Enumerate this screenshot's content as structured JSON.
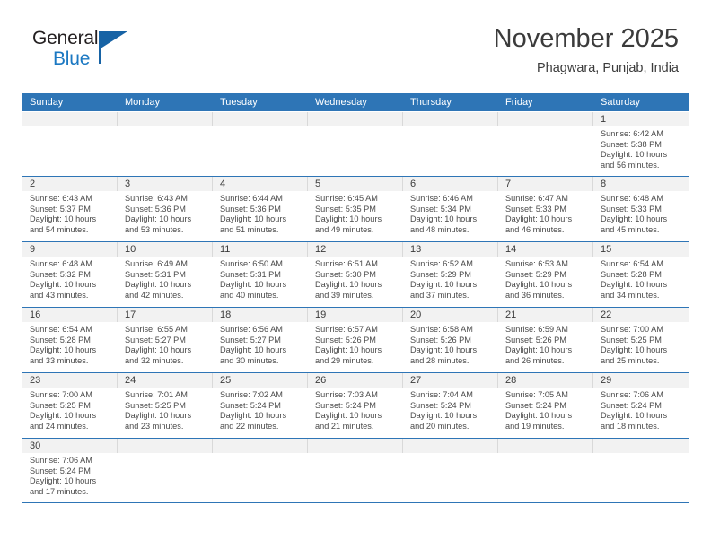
{
  "brand": {
    "name_part1": "General",
    "name_part2": "Blue"
  },
  "header": {
    "title": "November 2025",
    "subtitle": "Phagwara, Punjab, India"
  },
  "colors": {
    "header_blue": "#2e75b6",
    "brand_blue": "#1b78c2",
    "daynum_band": "#f2f2f2",
    "text": "#3b3b3b"
  },
  "weekdays": [
    "Sunday",
    "Monday",
    "Tuesday",
    "Wednesday",
    "Thursday",
    "Friday",
    "Saturday"
  ],
  "weeks": [
    [
      {
        "empty": true
      },
      {
        "empty": true
      },
      {
        "empty": true
      },
      {
        "empty": true
      },
      {
        "empty": true
      },
      {
        "empty": true
      },
      {
        "day": "1",
        "sunrise": "Sunrise: 6:42 AM",
        "sunset": "Sunset: 5:38 PM",
        "daylight1": "Daylight: 10 hours",
        "daylight2": "and 56 minutes."
      }
    ],
    [
      {
        "day": "2",
        "sunrise": "Sunrise: 6:43 AM",
        "sunset": "Sunset: 5:37 PM",
        "daylight1": "Daylight: 10 hours",
        "daylight2": "and 54 minutes."
      },
      {
        "day": "3",
        "sunrise": "Sunrise: 6:43 AM",
        "sunset": "Sunset: 5:36 PM",
        "daylight1": "Daylight: 10 hours",
        "daylight2": "and 53 minutes."
      },
      {
        "day": "4",
        "sunrise": "Sunrise: 6:44 AM",
        "sunset": "Sunset: 5:36 PM",
        "daylight1": "Daylight: 10 hours",
        "daylight2": "and 51 minutes."
      },
      {
        "day": "5",
        "sunrise": "Sunrise: 6:45 AM",
        "sunset": "Sunset: 5:35 PM",
        "daylight1": "Daylight: 10 hours",
        "daylight2": "and 49 minutes."
      },
      {
        "day": "6",
        "sunrise": "Sunrise: 6:46 AM",
        "sunset": "Sunset: 5:34 PM",
        "daylight1": "Daylight: 10 hours",
        "daylight2": "and 48 minutes."
      },
      {
        "day": "7",
        "sunrise": "Sunrise: 6:47 AM",
        "sunset": "Sunset: 5:33 PM",
        "daylight1": "Daylight: 10 hours",
        "daylight2": "and 46 minutes."
      },
      {
        "day": "8",
        "sunrise": "Sunrise: 6:48 AM",
        "sunset": "Sunset: 5:33 PM",
        "daylight1": "Daylight: 10 hours",
        "daylight2": "and 45 minutes."
      }
    ],
    [
      {
        "day": "9",
        "sunrise": "Sunrise: 6:48 AM",
        "sunset": "Sunset: 5:32 PM",
        "daylight1": "Daylight: 10 hours",
        "daylight2": "and 43 minutes."
      },
      {
        "day": "10",
        "sunrise": "Sunrise: 6:49 AM",
        "sunset": "Sunset: 5:31 PM",
        "daylight1": "Daylight: 10 hours",
        "daylight2": "and 42 minutes."
      },
      {
        "day": "11",
        "sunrise": "Sunrise: 6:50 AM",
        "sunset": "Sunset: 5:31 PM",
        "daylight1": "Daylight: 10 hours",
        "daylight2": "and 40 minutes."
      },
      {
        "day": "12",
        "sunrise": "Sunrise: 6:51 AM",
        "sunset": "Sunset: 5:30 PM",
        "daylight1": "Daylight: 10 hours",
        "daylight2": "and 39 minutes."
      },
      {
        "day": "13",
        "sunrise": "Sunrise: 6:52 AM",
        "sunset": "Sunset: 5:29 PM",
        "daylight1": "Daylight: 10 hours",
        "daylight2": "and 37 minutes."
      },
      {
        "day": "14",
        "sunrise": "Sunrise: 6:53 AM",
        "sunset": "Sunset: 5:29 PM",
        "daylight1": "Daylight: 10 hours",
        "daylight2": "and 36 minutes."
      },
      {
        "day": "15",
        "sunrise": "Sunrise: 6:54 AM",
        "sunset": "Sunset: 5:28 PM",
        "daylight1": "Daylight: 10 hours",
        "daylight2": "and 34 minutes."
      }
    ],
    [
      {
        "day": "16",
        "sunrise": "Sunrise: 6:54 AM",
        "sunset": "Sunset: 5:28 PM",
        "daylight1": "Daylight: 10 hours",
        "daylight2": "and 33 minutes."
      },
      {
        "day": "17",
        "sunrise": "Sunrise: 6:55 AM",
        "sunset": "Sunset: 5:27 PM",
        "daylight1": "Daylight: 10 hours",
        "daylight2": "and 32 minutes."
      },
      {
        "day": "18",
        "sunrise": "Sunrise: 6:56 AM",
        "sunset": "Sunset: 5:27 PM",
        "daylight1": "Daylight: 10 hours",
        "daylight2": "and 30 minutes."
      },
      {
        "day": "19",
        "sunrise": "Sunrise: 6:57 AM",
        "sunset": "Sunset: 5:26 PM",
        "daylight1": "Daylight: 10 hours",
        "daylight2": "and 29 minutes."
      },
      {
        "day": "20",
        "sunrise": "Sunrise: 6:58 AM",
        "sunset": "Sunset: 5:26 PM",
        "daylight1": "Daylight: 10 hours",
        "daylight2": "and 28 minutes."
      },
      {
        "day": "21",
        "sunrise": "Sunrise: 6:59 AM",
        "sunset": "Sunset: 5:26 PM",
        "daylight1": "Daylight: 10 hours",
        "daylight2": "and 26 minutes."
      },
      {
        "day": "22",
        "sunrise": "Sunrise: 7:00 AM",
        "sunset": "Sunset: 5:25 PM",
        "daylight1": "Daylight: 10 hours",
        "daylight2": "and 25 minutes."
      }
    ],
    [
      {
        "day": "23",
        "sunrise": "Sunrise: 7:00 AM",
        "sunset": "Sunset: 5:25 PM",
        "daylight1": "Daylight: 10 hours",
        "daylight2": "and 24 minutes."
      },
      {
        "day": "24",
        "sunrise": "Sunrise: 7:01 AM",
        "sunset": "Sunset: 5:25 PM",
        "daylight1": "Daylight: 10 hours",
        "daylight2": "and 23 minutes."
      },
      {
        "day": "25",
        "sunrise": "Sunrise: 7:02 AM",
        "sunset": "Sunset: 5:24 PM",
        "daylight1": "Daylight: 10 hours",
        "daylight2": "and 22 minutes."
      },
      {
        "day": "26",
        "sunrise": "Sunrise: 7:03 AM",
        "sunset": "Sunset: 5:24 PM",
        "daylight1": "Daylight: 10 hours",
        "daylight2": "and 21 minutes."
      },
      {
        "day": "27",
        "sunrise": "Sunrise: 7:04 AM",
        "sunset": "Sunset: 5:24 PM",
        "daylight1": "Daylight: 10 hours",
        "daylight2": "and 20 minutes."
      },
      {
        "day": "28",
        "sunrise": "Sunrise: 7:05 AM",
        "sunset": "Sunset: 5:24 PM",
        "daylight1": "Daylight: 10 hours",
        "daylight2": "and 19 minutes."
      },
      {
        "day": "29",
        "sunrise": "Sunrise: 7:06 AM",
        "sunset": "Sunset: 5:24 PM",
        "daylight1": "Daylight: 10 hours",
        "daylight2": "and 18 minutes."
      }
    ],
    [
      {
        "day": "30",
        "sunrise": "Sunrise: 7:06 AM",
        "sunset": "Sunset: 5:24 PM",
        "daylight1": "Daylight: 10 hours",
        "daylight2": "and 17 minutes."
      },
      {
        "empty": true
      },
      {
        "empty": true
      },
      {
        "empty": true
      },
      {
        "empty": true
      },
      {
        "empty": true
      },
      {
        "empty": true
      }
    ]
  ]
}
